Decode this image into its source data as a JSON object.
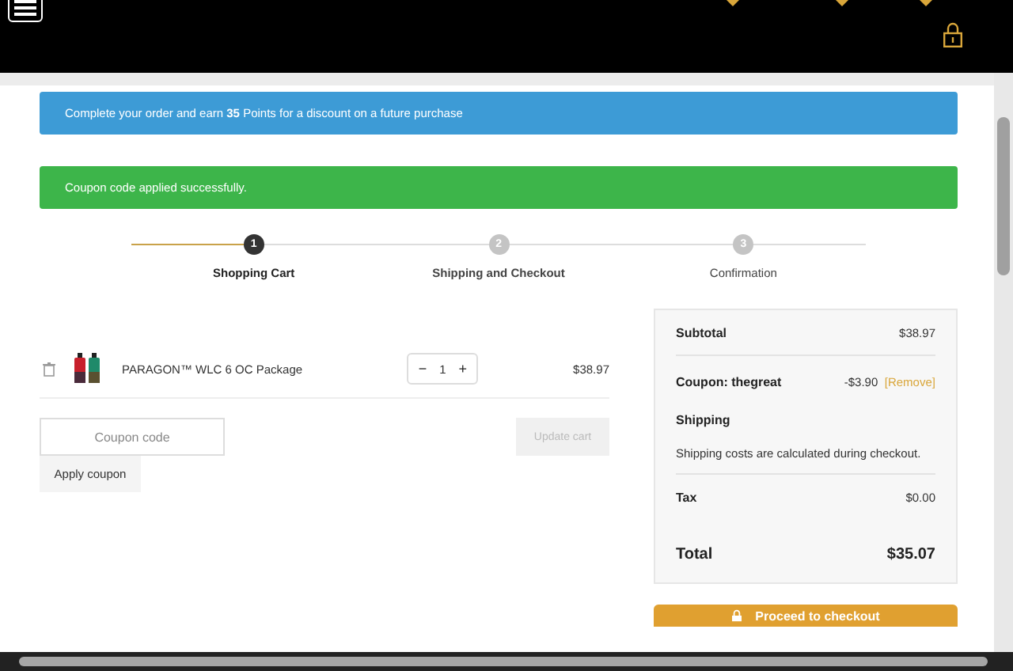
{
  "notices": [
    {
      "kind": "info",
      "text": "Complete your order and earn **35** Points for a discount on a future purchase"
    },
    {
      "kind": "success",
      "text": "Coupon code applied successfully."
    }
  ],
  "steps": [
    {
      "number": "1",
      "label": "Shopping Cart",
      "selected": true
    },
    {
      "number": "2",
      "label": "Shipping and Checkout",
      "selected": false
    },
    {
      "number": "3",
      "label": "Confirmation",
      "selected": false
    }
  ],
  "cart_items": [
    {
      "name": "PARAGON™ WLC 6 OC Package",
      "quantity": "1",
      "minus": "−",
      "plus": "+",
      "price": "$38.97"
    }
  ],
  "coupon": {
    "placeholder": "Coupon code",
    "apply_label": "Apply coupon"
  },
  "update_cart": {
    "label": "Update cart",
    "disabled": true
  },
  "summary": {
    "subtotal_label": "Subtotal",
    "subtotal": "$38.97",
    "coupon_label": "Coupon: thegreat",
    "coupon_amount": "-$3.90",
    "remove_label": "[Remove]",
    "shipping_label": "Shipping",
    "shipping_note": "Shipping costs are calculated during checkout.",
    "tax_label": "Tax",
    "tax": "$0.00",
    "total_label": "Total",
    "total": "$35.07"
  },
  "checkout_button": {
    "label": "Proceed to checkout"
  }
}
